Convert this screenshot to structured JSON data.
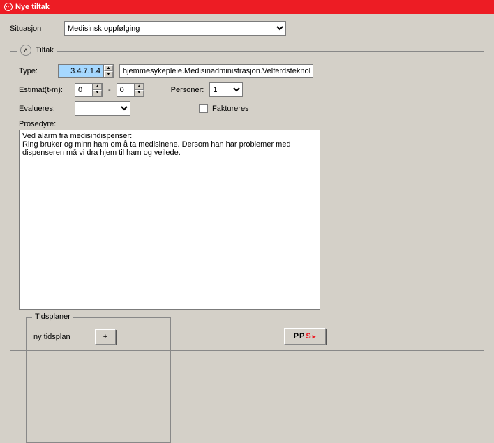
{
  "window": {
    "title": "Nye tiltak"
  },
  "situasjon": {
    "label": "Situasjon",
    "value": "Medisinsk oppfølging"
  },
  "tiltak": {
    "panel_title": "Tiltak",
    "type_label": "Type:",
    "type_code": "3.4.7.1.4",
    "type_desc": "hjemmesykepleie.Medisinadministrasjon.Velferdsteknologi",
    "estimat_label": "Estimat(t-m):",
    "estimat_from": "0",
    "estimat_sep": "-",
    "estimat_to": "0",
    "personer_label": "Personer:",
    "personer_value": "1",
    "evalueres_label": "Evalueres:",
    "evalueres_value": "",
    "faktureres_label": "Faktureres",
    "prosedyre_label": "Prosedyre:",
    "prosedyre_text": "Ved alarm fra medisindispenser:\nRing bruker og minn ham om å ta medisinene. Dersom han har problemer med dispenseren må vi dra hjem til ham og veilede."
  },
  "tidsplaner": {
    "legend": "Tidsplaner",
    "ny_label": "ny tidsplan",
    "add_label": "+"
  },
  "pps": {
    "p": "PP",
    "s": "S",
    "arrow": "▸"
  }
}
